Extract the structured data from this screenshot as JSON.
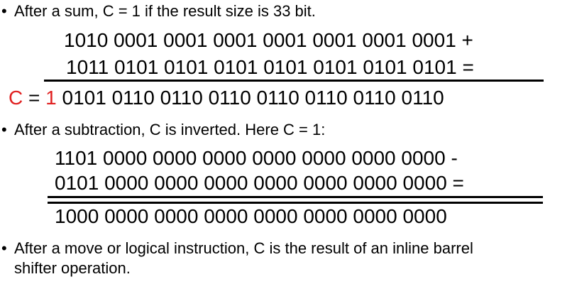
{
  "bullets": {
    "b1": "After a sum, C = 1 if the result size is 33 bit.",
    "b2": "After a subtraction, C is inverted. Here C = 1:",
    "b3_line1": "After a move or logical instruction, C is the result of an inline barrel",
    "b3_line2": "shifter operation.",
    "bullet_char": "•"
  },
  "sum": {
    "operand1": "1010 0001 0001 0001 0001 0001 0001 0001 +",
    "operand2": "1011 0101 0101 0101 0101 0101 0101 0101 =",
    "carry_label": "C",
    "equals": "=",
    "carry_value": "1",
    "result": "0101 0110 0110 0110 0110 0110 0110 0110"
  },
  "subtraction": {
    "operand1": "1101 0000 0000 0000 0000 0000 0000 0000 -",
    "operand2": "0101 0000 0000 0000 0000 0000 0000 0000 =",
    "result": "1000 0000 0000 0000 0000 0000 0000 0000"
  },
  "colors": {
    "carry": "#e02020",
    "text": "#000000",
    "background": "#ffffff"
  }
}
